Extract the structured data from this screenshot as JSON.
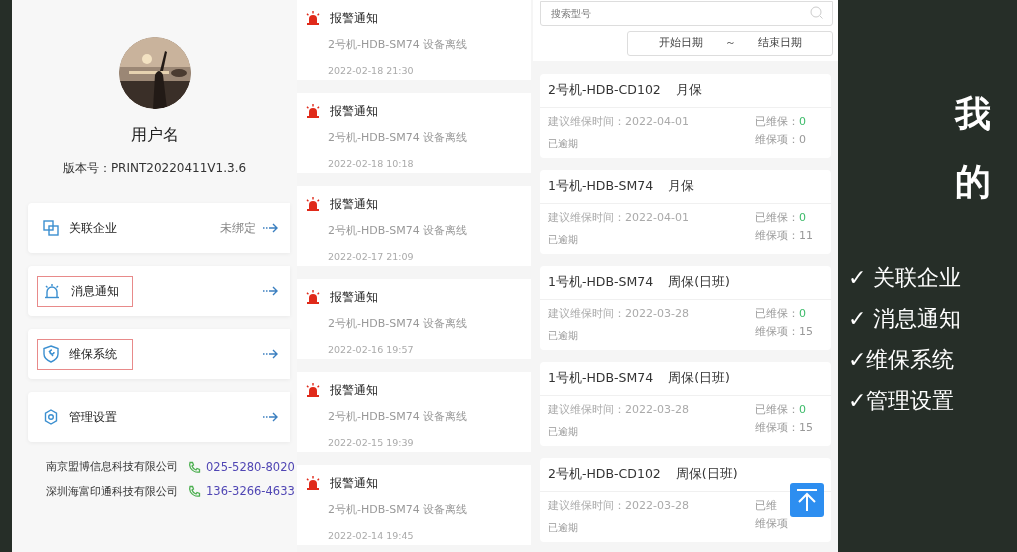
{
  "profile": {
    "kind": "picture",
    "username": "用户名",
    "version": "版本号：PRINT20220411V1.3.6"
  },
  "menu": [
    {
      "kind": "link",
      "label": "关联企业",
      "value": "未绑定",
      "outlined": false
    },
    {
      "kind": "bell",
      "label": "消息通知",
      "outlined": true
    },
    {
      "kind": "shield",
      "label": "维保系统",
      "outlined": true
    },
    {
      "kind": "gear",
      "label": "管理设置",
      "outlined": false
    }
  ],
  "contacts": [
    {
      "company": "南京盟博信息科技有限公司",
      "phone": "025-5280-8020"
    },
    {
      "company": "深圳海富印通科技有限公司",
      "phone": "136-3266-4633"
    }
  ],
  "alerts": [
    {
      "title": "报警通知",
      "message": "2号机-HDB-SM74 设备离线",
      "time": "2022-02-18 21:30"
    },
    {
      "title": "报警通知",
      "message": "2号机-HDB-SM74 设备离线",
      "time": "2022-02-18 10:18"
    },
    {
      "title": "报警通知",
      "message": "2号机-HDB-SM74 设备离线",
      "time": "2022-02-17 21:09"
    },
    {
      "title": "报警通知",
      "message": "2号机-HDB-SM74 设备离线",
      "time": "2022-02-16 19:57"
    },
    {
      "title": "报警通知",
      "message": "2号机-HDB-SM74 设备离线",
      "time": "2022-02-15 19:39"
    },
    {
      "title": "报警通知",
      "message": "2号机-HDB-SM74 设备离线",
      "time": "2022-02-14 19:45"
    }
  ],
  "maintenance": {
    "search": {
      "placeholder": "搜索型号"
    },
    "start_date": "开始日期",
    "separator": "～",
    "end_date": "结束日期",
    "records": [
      {
        "machine": "2号机-HDB-CD102",
        "plan": "月保",
        "suggested": "建议维保时间：2022-04-01",
        "status": "已逾期",
        "done_label": "已维保：",
        "done": "0",
        "items_label": "维保项：",
        "items": "0"
      },
      {
        "machine": "1号机-HDB-SM74",
        "plan": "月保",
        "suggested": "建议维保时间：2022-04-01",
        "status": "已逾期",
        "done_label": "已维保：",
        "done": "0",
        "items_label": "维保项：",
        "items": "11"
      },
      {
        "machine": "1号机-HDB-SM74",
        "plan": "周保(日班)",
        "suggested": "建议维保时间：2022-03-28",
        "status": "已逾期",
        "done_label": "已维保：",
        "done": "0",
        "items_label": "维保项：",
        "items": "15"
      },
      {
        "machine": "1号机-HDB-SM74",
        "plan": "周保(日班)",
        "suggested": "建议维保时间：2022-03-28",
        "status": "已逾期",
        "done_label": "已维保：",
        "done": "0",
        "items_label": "维保项：",
        "items": "15"
      },
      {
        "machine": "2号机-HDB-CD102",
        "plan": "周保(日班)",
        "suggested": "建议维保时间：2022-03-28",
        "status": "已逾期",
        "done_label": "已维",
        "items_label": "维保项"
      }
    ]
  },
  "caption": {
    "title": "我的",
    "features": [
      "✓ 关联企业",
      "✓ 消息通知",
      "✓维保系统",
      "✓管理设置"
    ]
  }
}
